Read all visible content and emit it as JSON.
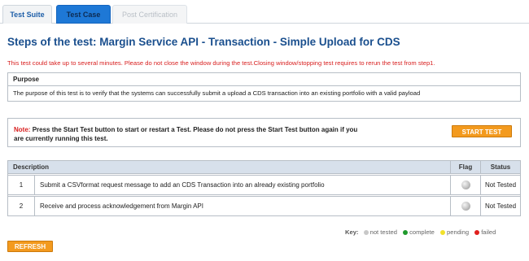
{
  "tabs": {
    "test_suite": "Test Suite",
    "test_case": "Test Case",
    "post_certification": "Post Certification"
  },
  "page_title": "Steps of the test: Margin Service API - Transaction - Simple Upload for CDS",
  "warning": "This test could take up to several minutes. Please do not close the window during the test.Closing window/stopping test requires to rerun the test from step1.",
  "purpose": {
    "heading": "Purpose",
    "text": "The purpose of this test is to verify that the systems can successfully submit a upload a CDS transaction into an existing portfolio with a valid payload"
  },
  "note": {
    "label": "Note:",
    "text": "Press the Start Test button to start or restart a Test. Please do not press the Start Test button again if you are currently running this test."
  },
  "start_button": "START TEST",
  "table": {
    "headers": {
      "description": "Description",
      "flag": "Flag",
      "status": "Status"
    },
    "rows": [
      {
        "number": "1",
        "description": "Submit a CSVformat request message to add an CDS Transaction into an already existing portfolio",
        "status": "Not Tested"
      },
      {
        "number": "2",
        "description": "Receive and process acknowledgement from Margin API",
        "status": "Not Tested"
      }
    ]
  },
  "key": {
    "label": "Key:",
    "items": [
      {
        "label": "not tested",
        "color": "#c8c8c8"
      },
      {
        "label": "complete",
        "color": "#1f9a2c"
      },
      {
        "label": "pending",
        "color": "#f2e12a"
      },
      {
        "label": "failed",
        "color": "#e0201e"
      }
    ]
  },
  "refresh_button": "REFRESH",
  "colors": {
    "accent_orange": "#f39a1e",
    "tab_active": "#1e78d6",
    "title_blue": "#1a4f8e",
    "warning_red": "#d81e1e"
  }
}
